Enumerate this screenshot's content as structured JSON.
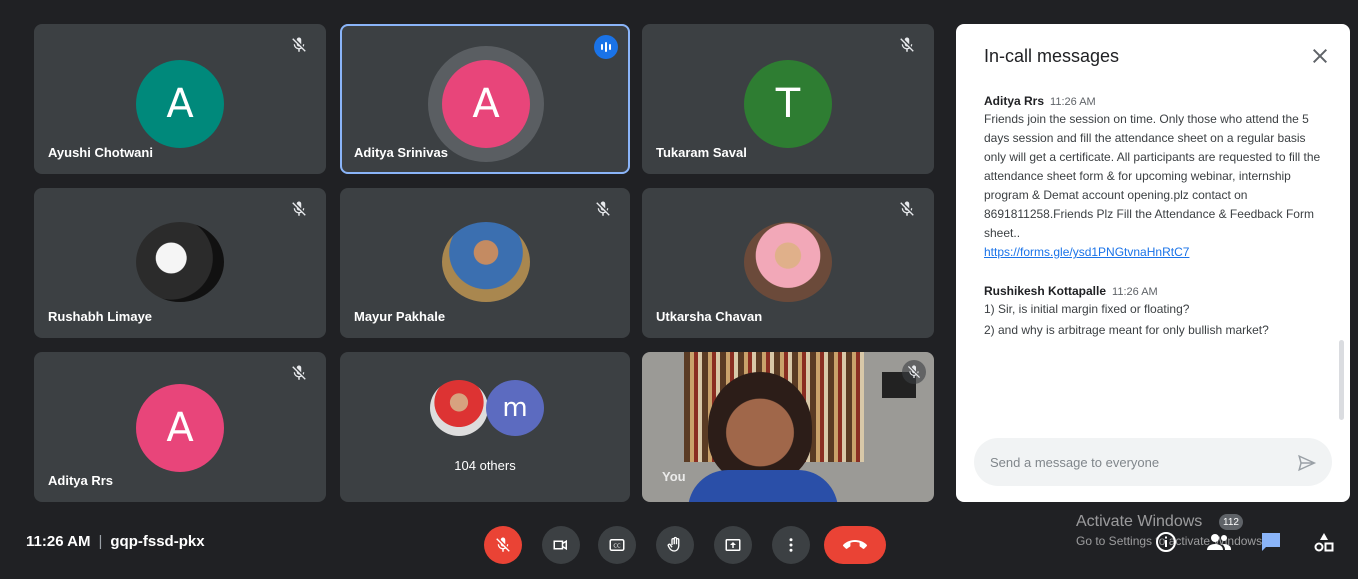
{
  "participants": [
    {
      "name": "Ayushi Chotwani",
      "initial": "A",
      "color": "#00897b"
    },
    {
      "name": "Aditya Srinivas",
      "initial": "A",
      "color": "#e8457a"
    },
    {
      "name": "Tukaram Saval",
      "initial": "T",
      "color": "#2e7d32"
    },
    {
      "name": "Rushabh Limaye"
    },
    {
      "name": "Mayur Pakhale"
    },
    {
      "name": "Utkarsha Chavan"
    },
    {
      "name": "Aditya Rrs",
      "initial": "A",
      "color": "#e8457a"
    },
    {
      "others_initial": "m",
      "others_label": "104 others"
    },
    {
      "name": "You"
    }
  ],
  "chat": {
    "title": "In-call messages",
    "messages": [
      {
        "sender": "Aditya Rrs",
        "time": "11:26 AM",
        "text": "Friends join the session on time. Only those who attend the 5 days session and fill the attendance sheet on a regular basis only will get a certificate. All participants are requested to fill the attendance sheet form & for upcoming webinar, internship program & Demat account opening.plz contact on 8691811258.Friends Plz Fill the Attendance & Feedback Form sheet..",
        "link": "https://forms.gle/ysd1PNGtvnaHnRtC7"
      },
      {
        "sender": "Rushikesh Kottapalle",
        "time": "11:26 AM",
        "line1": "1) Sir, is initial margin fixed or floating?",
        "line2": "2) and why is arbitrage meant for only bullish market?"
      }
    ],
    "input_placeholder": "Send a message to everyone"
  },
  "footer": {
    "time": "11:26 AM",
    "separator": "|",
    "meeting_code": "gqp-fssd-pkx",
    "participants_count": "112"
  },
  "watermark": {
    "line1": "Activate Windows",
    "line2": "Go to Settings to activate Windows."
  },
  "icons": {
    "tile_mute": "mic-off-icon",
    "speaking": "audio-level-icon",
    "close": "close-icon",
    "send": "send-icon",
    "controls": [
      "mic-off-icon",
      "camera-icon",
      "captions-icon",
      "raise-hand-icon",
      "present-icon",
      "more-vert-icon",
      "call-end-icon"
    ],
    "side": [
      "info-icon",
      "people-icon",
      "chat-icon",
      "activities-icon"
    ]
  },
  "colors": {
    "background": "#202124",
    "tile": "#3c4043",
    "active_outline": "#8ab4f8",
    "danger": "#ea4335",
    "accent": "#1a73e8",
    "chat_bg": "#ffffff"
  }
}
